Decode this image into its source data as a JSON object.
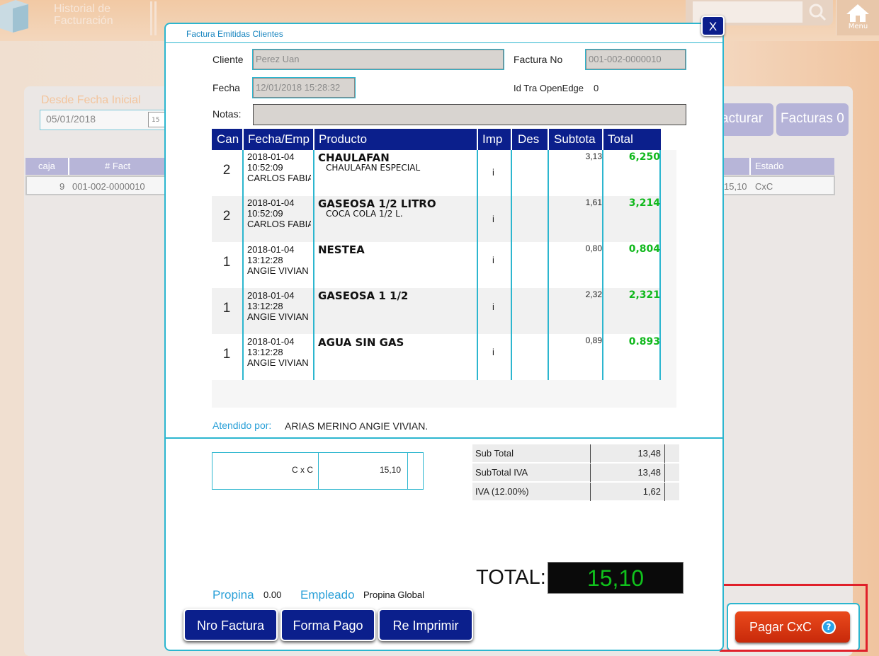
{
  "app": {
    "title_line1": "Historial de",
    "title_line2": "Facturación",
    "menu_label": "Menu"
  },
  "filters": {
    "desde_label": "Desde Fecha Inicial",
    "desde_value": "05/01/2018",
    "cal_text": "15"
  },
  "bg_buttons": {
    "facturar": "acturar",
    "facturas": "Facturas 0"
  },
  "bg_table": {
    "headers": {
      "caja": "caja",
      "fact": "# Fact",
      "estado": "Estado"
    },
    "row": {
      "caja": "9",
      "fact": "001-002-0000010",
      "total": "15,10",
      "estado": "CxC"
    }
  },
  "modal": {
    "title": "Factura Emitidas Clientes",
    "close": "X",
    "cliente_label": "Cliente",
    "cliente_value": "Perez Uan",
    "factura_label": "Factura No",
    "factura_value": "001-002-0000010",
    "fecha_label": "Fecha",
    "fecha_value": "12/01/2018 15:28:32",
    "idtra_label": "Id Tra OpenEdge",
    "idtra_value": "0",
    "notas_label": "Notas:",
    "notas_value": ""
  },
  "grid": {
    "headers": {
      "can": "Can",
      "fecha": "Fecha/Emp",
      "producto": "Producto",
      "imp": "Imp",
      "des": "Des",
      "subtotal": "Subtota",
      "total": "Total"
    },
    "rows": [
      {
        "qty": "2",
        "date": "2018-01-04",
        "time": "10:52:09",
        "emp": "CARLOS FABIA",
        "name": "CHAULAFAN",
        "desc": "CHAULAFAN ESPECIAL",
        "imp": "i",
        "sub": "3,13",
        "tot": "6,250"
      },
      {
        "qty": "2",
        "date": "2018-01-04",
        "time": "10:52:09",
        "emp": "CARLOS FABIA",
        "name": "GASEOSA 1/2 LITRO",
        "desc": "COCA COLA 1/2 L.",
        "imp": "i",
        "sub": "1,61",
        "tot": "3,214"
      },
      {
        "qty": "1",
        "date": "2018-01-04",
        "time": "13:12:28",
        "emp": "ANGIE VIVIAN",
        "name": "NESTEA",
        "desc": "",
        "imp": "i",
        "sub": "0,80",
        "tot": "0,804"
      },
      {
        "qty": "1",
        "date": "2018-01-04",
        "time": "13:12:28",
        "emp": "ANGIE VIVIAN",
        "name": "GASEOSA 1 1/2",
        "desc": "",
        "imp": "i",
        "sub": "2,32",
        "tot": "2,321"
      },
      {
        "qty": "1",
        "date": "2018-01-04",
        "time": "13:12:28",
        "emp": "ANGIE VIVIAN",
        "name": "AGUA SIN GAS",
        "desc": "",
        "imp": "i",
        "sub": "0,89",
        "tot": "0.893"
      }
    ]
  },
  "atendido": {
    "label": "Atendido por:",
    "value": "ARIAS MERINO ANGIE VIVIAN."
  },
  "payment": {
    "method": "C x C",
    "amount": "15,10"
  },
  "summary": {
    "subtotal_label": "Sub Total",
    "subtotal": "13,48",
    "subtotal_iva_label": "SubTotal IVA",
    "subtotal_iva": "13,48",
    "iva_label": "IVA (12.00%)",
    "iva": "1,62"
  },
  "total": {
    "label": "TOTAL:",
    "value": "15,10"
  },
  "footer": {
    "propina_label": "Propina",
    "propina_value": "0.00",
    "empleado_label": "Empleado",
    "empleado_value": "Propina Global"
  },
  "buttons": {
    "nro_factura": "Nro Factura",
    "forma_pago": "Forma Pago",
    "re_imprimir": "Re Imprimir",
    "pagar": "Pagar CxC",
    "help": "?"
  },
  "colors": {
    "accent": "#2cb6cf",
    "navy": "#0b1f8c",
    "green": "#10b81c",
    "red": "#e0202a"
  }
}
